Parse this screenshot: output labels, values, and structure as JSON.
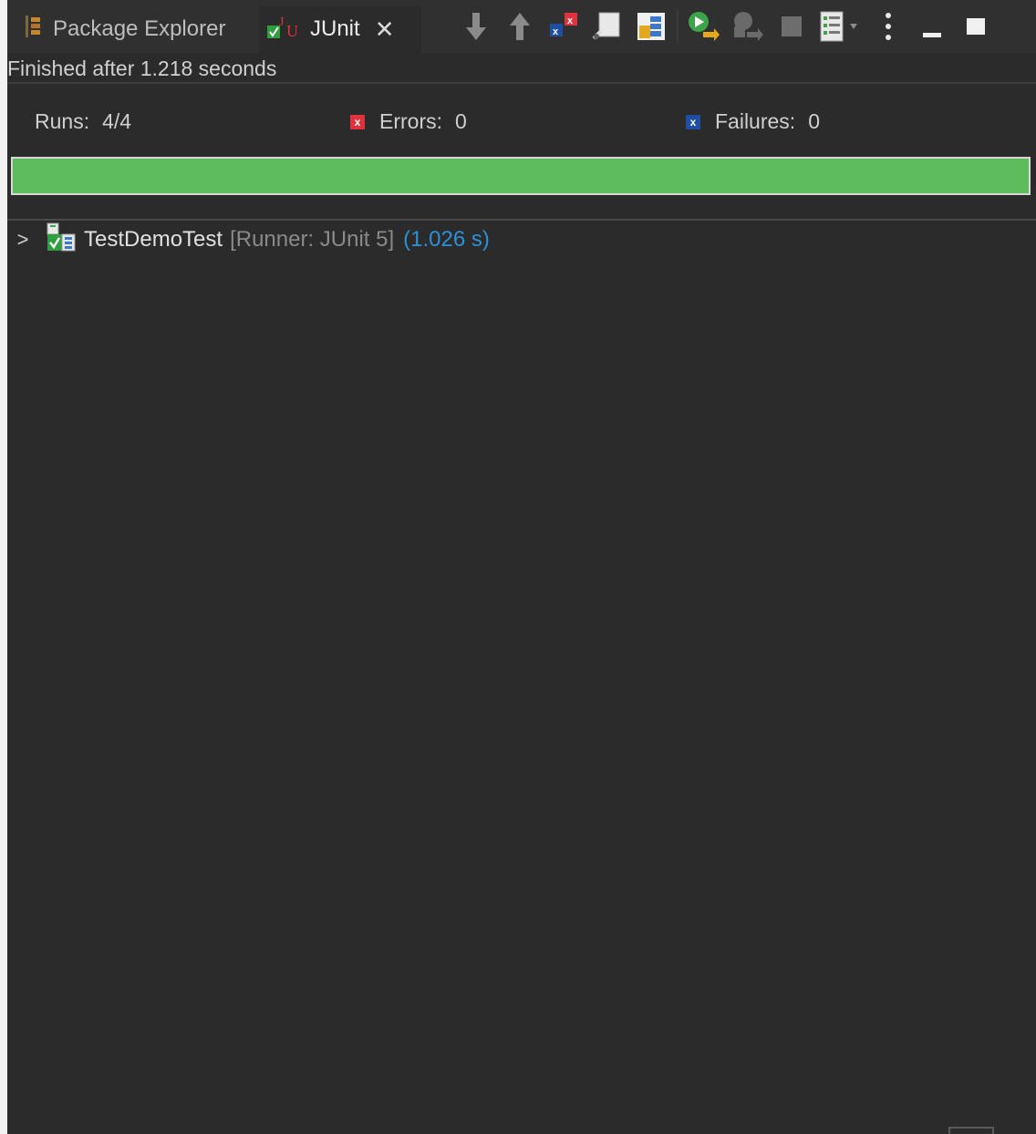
{
  "tabs": {
    "package_explorer": "Package Explorer",
    "junit": "JUnit",
    "close_glyph": "✕"
  },
  "toolbar": {
    "icons": [
      "next-failure-icon",
      "previous-failure-icon",
      "show-failures-only-icon",
      "scroll-lock-icon",
      "show-skipped-icon",
      "rerun-icon",
      "rerun-failures-first-icon",
      "stop-icon",
      "test-history-icon",
      "view-menu-icon",
      "minimize-icon",
      "maximize-icon"
    ]
  },
  "status": {
    "message": "Finished after 1.218 seconds"
  },
  "counters": {
    "runs_label": "Runs:",
    "runs_value": "4/4",
    "errors_label": "Errors:",
    "errors_value": "0",
    "failures_label": "Failures:",
    "failures_value": "0"
  },
  "progress": {
    "fraction": 1.0,
    "color": "#5ebc5a"
  },
  "tree": {
    "name": "TestDemoTest",
    "runner": "[Runner: JUnit 5]",
    "time": "(1.026 s)",
    "chevron": ">"
  },
  "colors": {
    "background": "#2b2b2b",
    "success": "#5ebc5a",
    "error": "#e0323e",
    "failure": "#1e4fa3",
    "time": "#2d90d8"
  }
}
